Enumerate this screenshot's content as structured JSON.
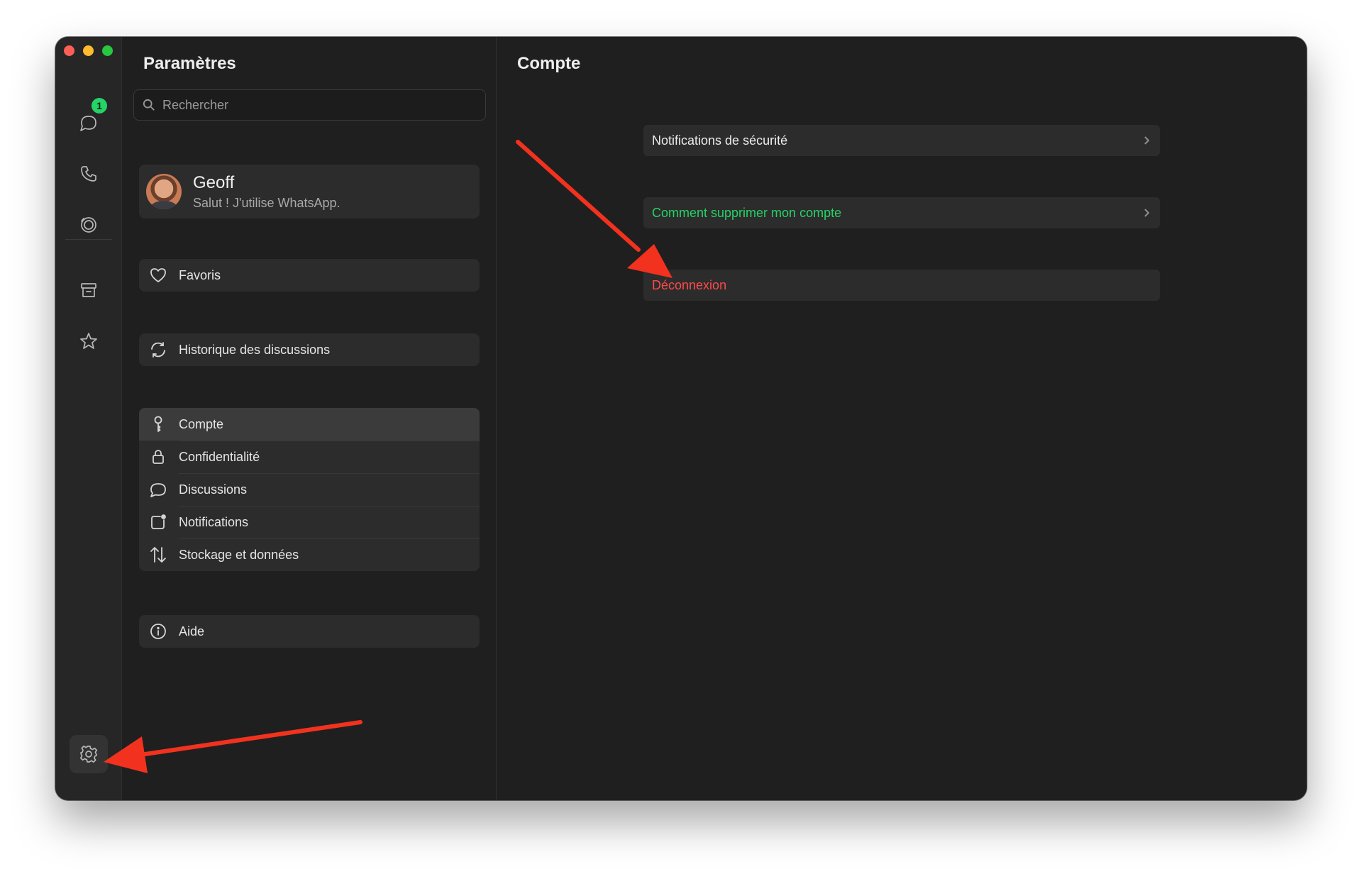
{
  "rail": {
    "chats_badge": "1",
    "icons": [
      "chat-icon",
      "phone-icon",
      "status-icon",
      "archive-icon",
      "star-icon",
      "gear-icon"
    ]
  },
  "settings": {
    "title": "Paramètres",
    "search_placeholder": "Rechercher",
    "profile": {
      "name": "Geoff",
      "status": "Salut ! J'utilise WhatsApp."
    },
    "favorites": "Favoris",
    "history": "Historique des discussions",
    "group_items": [
      {
        "label": "Compte",
        "icon": "key-icon",
        "selected": true
      },
      {
        "label": "Confidentialité",
        "icon": "lock-icon"
      },
      {
        "label": "Discussions",
        "icon": "chat-bubble-icon"
      },
      {
        "label": "Notifications",
        "icon": "notification-icon"
      },
      {
        "label": "Stockage et données",
        "icon": "arrows-icon"
      }
    ],
    "help": "Aide"
  },
  "detail": {
    "title": "Compte",
    "security_notifications": "Notifications de sécurité",
    "delete_account": "Comment supprimer mon compte",
    "logout": "Déconnexion",
    "colors": {
      "link": "#25d366",
      "danger": "#ff4a4a"
    }
  },
  "annotation": {
    "arrow_color": "#f2321e"
  }
}
